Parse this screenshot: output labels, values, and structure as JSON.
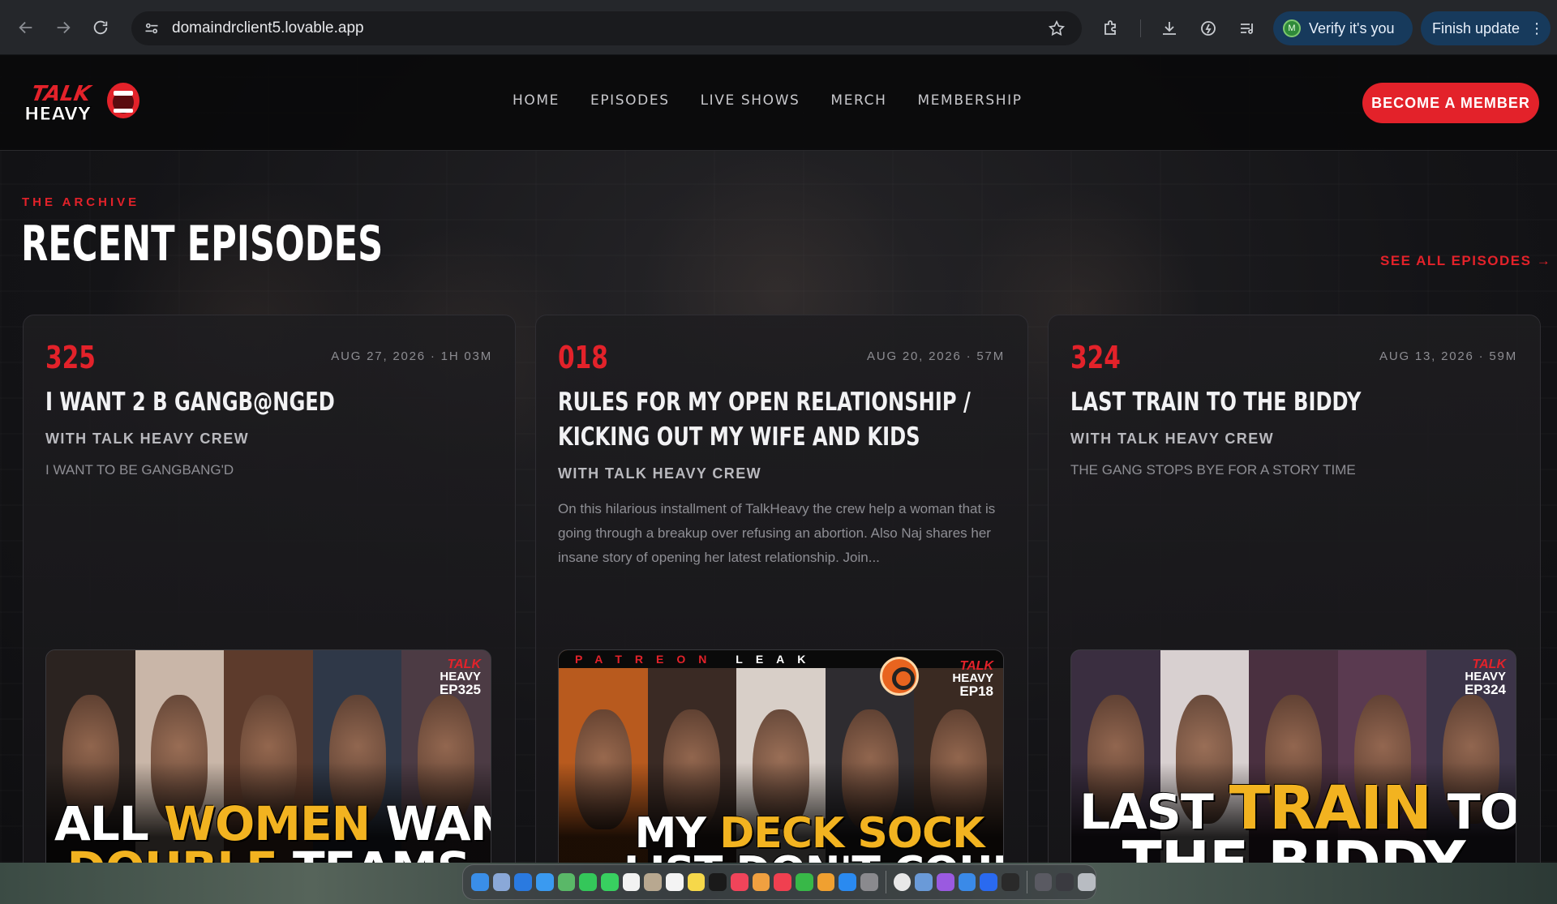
{
  "browser": {
    "url": "domaindrclient5.lovable.app",
    "verify_label": "Verify it's you",
    "verify_avatar": "M",
    "finish_label": "Finish update",
    "kebab": "⋮"
  },
  "site": {
    "logo": {
      "line1": "TALK",
      "line2": "HEAVY"
    },
    "nav": [
      "HOME",
      "EPISODES",
      "LIVE SHOWS",
      "MERCH",
      "MEMBERSHIP"
    ],
    "cta_label": "BECOME A MEMBER",
    "eyebrow": "THE ARCHIVE",
    "section_title": "RECENT EPISODES",
    "see_all": "SEE ALL EPISODES →",
    "accent_color": "#e3222a"
  },
  "episodes": [
    {
      "number": "325",
      "meta": "AUG 27, 2026 · 1H 03M",
      "title": "I WANT 2 B GANGB@NGED",
      "host": "WITH TALK HEAVY CREW",
      "description": "I WANT TO BE GANGBANG'D",
      "thumb": {
        "badge_talk": "TALK",
        "badge_heavy": "HEAVY",
        "badge_ep": "EP325",
        "line1_a": "ALL ",
        "line1_b": "WOMEN",
        "line1_c": " WANT",
        "line2_a": "DOUBLE",
        "line2_b": " TEAMS"
      }
    },
    {
      "number": "018",
      "meta": "AUG 20, 2026 · 57M",
      "title": "RULES FOR MY OPEN RELATIONSHIP / KICKING OUT MY WIFE AND KIDS",
      "host": "WITH TALK HEAVY CREW",
      "description": "On this hilarious installment of TalkHeavy the crew help a woman that is going through a breakup over refusing an abortion. Also Naj shares her insane story of opening her latest relationship. Join...",
      "thumb": {
        "band_a": "PATREON",
        "band_b": "LEAK",
        "badge_talk": "TALK",
        "badge_heavy": "HEAVY",
        "badge_ep": "EP18",
        "line1_a": "MY ",
        "line1_b": "DECK SOCK",
        "line2_a": "LIST DON'T COUNT"
      }
    },
    {
      "number": "324",
      "meta": "AUG 13, 2026 · 59M",
      "title": "LAST TRAIN TO THE BIDDY",
      "host": "WITH TALK HEAVY CREW",
      "description": "THE GANG STOPS BYE FOR A STORY TIME",
      "thumb": {
        "badge_talk": "TALK",
        "badge_heavy": "HEAVY",
        "badge_ep": "EP324",
        "line1_a": "LAST ",
        "line1_b": "TRAIN",
        "line1_c": " TO",
        "line2_a": "THE BIDDY"
      }
    }
  ]
}
